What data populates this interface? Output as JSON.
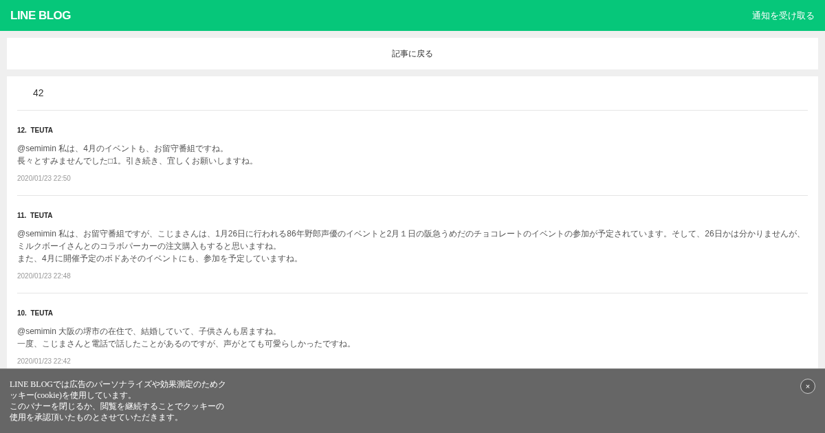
{
  "header": {
    "logo": "LINE BLOG",
    "notify_link": "通知を受け取る"
  },
  "back_link": "記事に戻る",
  "comments": {
    "count": "42",
    "items": [
      {
        "number": "12.",
        "author": "TEUTA",
        "lines": [
          "@semimin 私は、4月のイベントも、お留守番組ですね。",
          "長々とすみませんでした□1。引き続き、宜しくお願いしますね。"
        ],
        "date": "2020/01/23 22:50"
      },
      {
        "number": "11.",
        "author": "TEUTA",
        "lines": [
          "@semimin 私は、お留守番組ですが、こじまさんは、1月26日に行われる86年野郎声優のイベントと2月１日の阪急うめだのチョコレートのイベントの参加が予定されています。そして、26日かは分かりませんが、",
          "ミルクボーイさんとのコラボパーカーの注文購入もすると思いますね。",
          "また、4月に開催予定のボドあそのイベントにも、参加を予定していますね。"
        ],
        "date": "2020/01/23 22:48"
      },
      {
        "number": "10.",
        "author": "TEUTA",
        "lines": [
          "@semimin 大阪の堺市の在住で、結婚していて、子供さんも居ますね。",
          "一度、こじまさんと電話で話したことがあるのですが、声がとても可愛らしかったですね。"
        ],
        "date": "2020/01/23 22:42"
      }
    ]
  },
  "cookie_banner": {
    "lines": [
      "LINE BLOGでは広告のパーソナライズや効果測定のためク",
      "ッキー(cookie)を使用しています。",
      "このバナーを閉じるか、閲覧を継続することでクッキーの",
      "使用を承認頂いたものとさせていただきます。"
    ],
    "close": "×"
  }
}
